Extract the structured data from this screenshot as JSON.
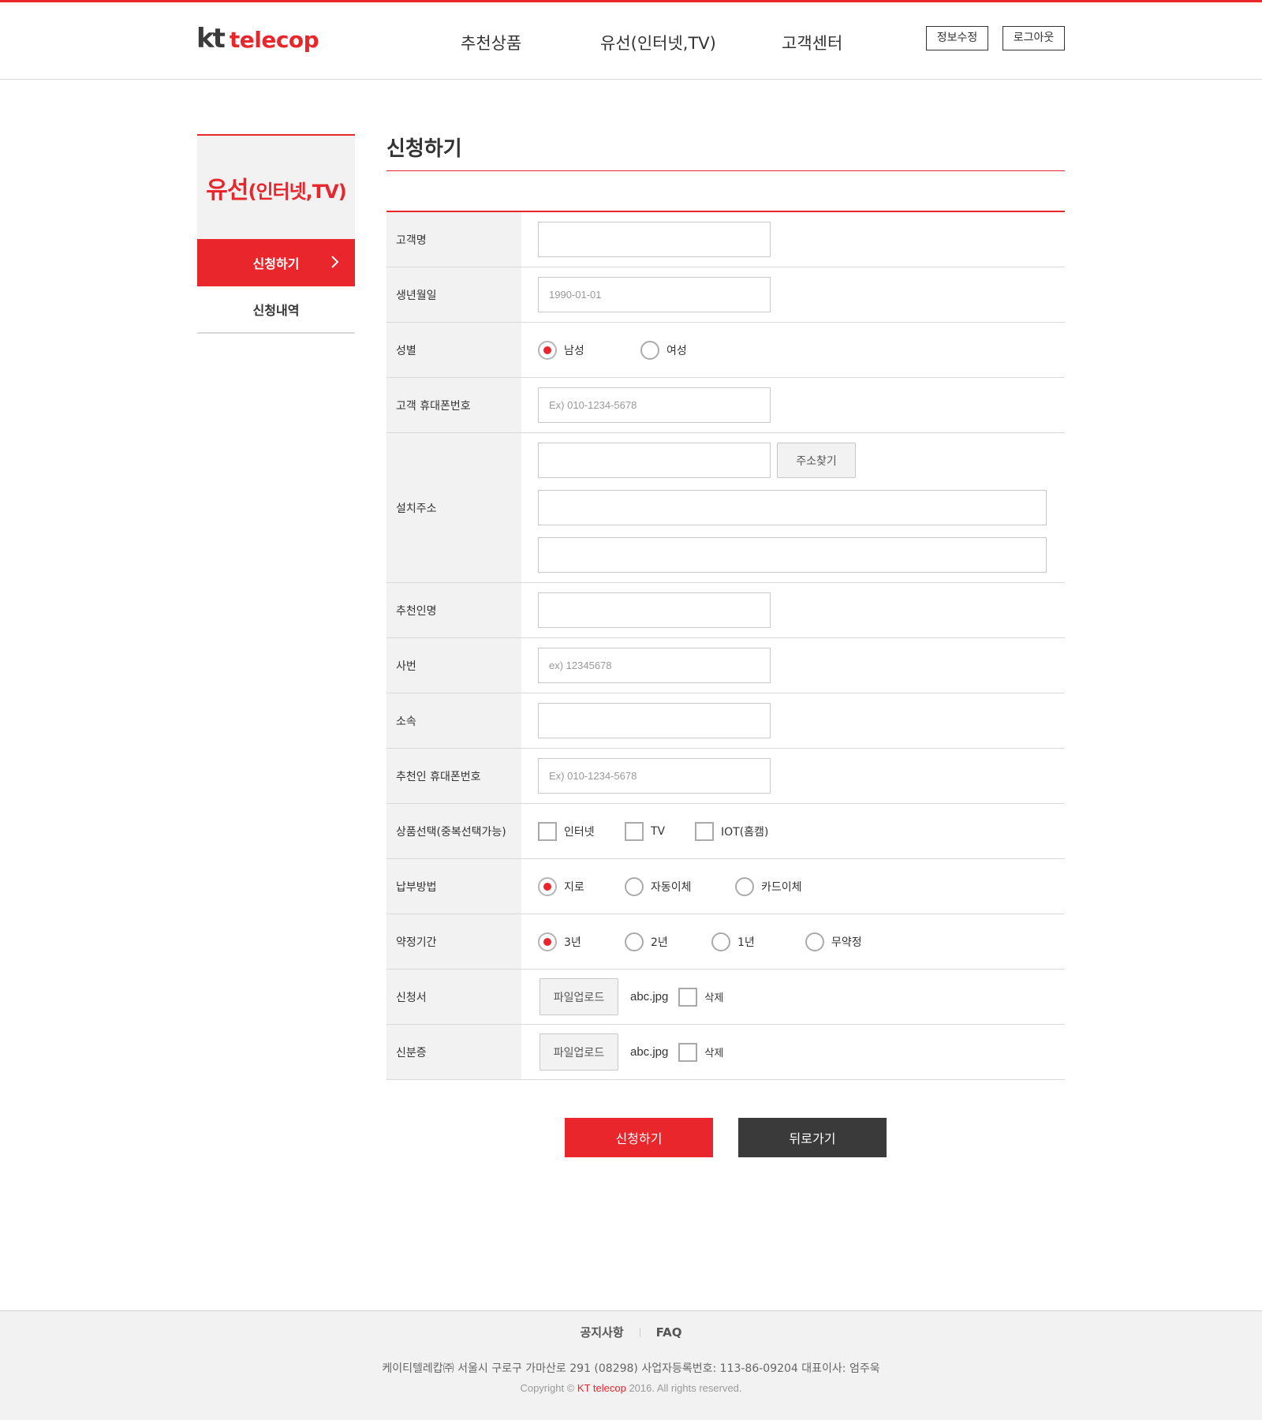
{
  "header": {
    "logo_kt": "kt",
    "logo_telecop": "telecop",
    "nav": [
      "추천상품",
      "유선(인터넷,TV)",
      "고객센터"
    ],
    "edit_info": "정보수정",
    "logout": "로그아웃"
  },
  "sidebar": {
    "title_main": "유선",
    "title_sub": "(인터넷,TV)",
    "items": [
      {
        "label": "신청하기",
        "active": true
      },
      {
        "label": "신청내역",
        "active": false
      }
    ]
  },
  "main": {
    "title": "신청하기"
  },
  "form": {
    "name_label": "고객명",
    "birth_label": "생년월일",
    "birth_placeholder": "1990-01-01",
    "gender_label": "성별",
    "gender_options": [
      "남성",
      "여성"
    ],
    "gender_selected": "남성",
    "phone_label": "고객 휴대폰번호",
    "phone_placeholder": "Ex) 010-1234-5678",
    "address_label": "설치주소",
    "address_button": "주소찾기",
    "referrer_label": "추천인명",
    "emp_no_label": "사번",
    "emp_no_placeholder": "ex) 12345678",
    "dept_label": "소속",
    "referrer_phone_label": "추천인 휴대폰번호",
    "referrer_phone_placeholder": "Ex) 010-1234-5678",
    "product_label": "상품선택(중복선택가능)",
    "product_options": [
      "인터넷",
      "TV",
      "IOT(홈캠)"
    ],
    "payment_label": "납부방법",
    "payment_options": [
      "지로",
      "자동이체",
      "카드이체"
    ],
    "payment_selected": "지로",
    "contract_label": "약정기간",
    "contract_options": [
      "3년",
      "2년",
      "1년",
      "무약정"
    ],
    "contract_selected": "3년",
    "application_label": "신청서",
    "id_label": "신분증",
    "upload_button": "파일업로드",
    "application_file": "abc.jpg",
    "id_file": "abc.jpg",
    "delete_label": "삭제"
  },
  "actions": {
    "submit": "신청하기",
    "back": "뒤로가기"
  },
  "footer": {
    "links": [
      "공지사항",
      "FAQ"
    ],
    "info": "케이티텔레캅㈜  서울시 구로구 가마산로 291 (08298)  사업자등록번호: 113-86-09204  대표이사: 엄주욱",
    "copyright_pre": "Copyright © ",
    "copyright_brand": "KT telecop",
    "copyright_post": " 2016. All rights reserved."
  },
  "colors": {
    "accent": "#e8262b",
    "dark_button": "#3a3a3a",
    "label_bg": "#f2f2f2"
  }
}
